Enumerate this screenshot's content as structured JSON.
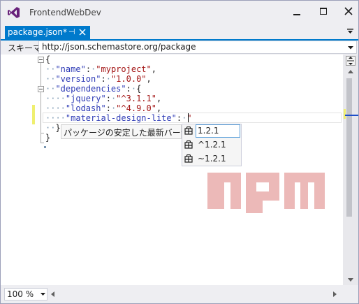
{
  "window": {
    "title": "FrontendWebDev"
  },
  "tab": {
    "label": "package.json*",
    "pin_glyph": "⊣"
  },
  "schema": {
    "label": "スキーマ:",
    "value": "http://json.schemastore.org/package"
  },
  "code": {
    "lines": [
      [
        {
          "t": "{",
          "c": "pun"
        }
      ],
      [
        {
          "t": "··",
          "c": "ws"
        },
        {
          "t": "\"name\"",
          "c": "key"
        },
        {
          "t": ":",
          "c": "pun"
        },
        {
          "t": "·",
          "c": "ws"
        },
        {
          "t": "\"myproject\"",
          "c": "str"
        },
        {
          "t": ",",
          "c": "pun"
        }
      ],
      [
        {
          "t": "··",
          "c": "ws"
        },
        {
          "t": "\"version\"",
          "c": "key"
        },
        {
          "t": ":",
          "c": "pun"
        },
        {
          "t": "·",
          "c": "ws"
        },
        {
          "t": "\"1.0.0\"",
          "c": "str"
        },
        {
          "t": ",",
          "c": "pun"
        }
      ],
      [
        {
          "t": "··",
          "c": "ws"
        },
        {
          "t": "\"dependencies\"",
          "c": "key"
        },
        {
          "t": ":",
          "c": "pun"
        },
        {
          "t": "·",
          "c": "ws"
        },
        {
          "t": "{",
          "c": "pun"
        }
      ],
      [
        {
          "t": "····",
          "c": "ws"
        },
        {
          "t": "\"jquery\"",
          "c": "key"
        },
        {
          "t": ":",
          "c": "pun"
        },
        {
          "t": "·",
          "c": "ws"
        },
        {
          "t": "\"^3.1.1\"",
          "c": "str"
        },
        {
          "t": ",",
          "c": "pun"
        }
      ],
      [
        {
          "t": "····",
          "c": "ws"
        },
        {
          "t": "\"lodash\"",
          "c": "key"
        },
        {
          "t": ":",
          "c": "pun"
        },
        {
          "t": "·",
          "c": "ws"
        },
        {
          "t": "\"^4.9.0\"",
          "c": "str"
        },
        {
          "t": ",",
          "c": "pun"
        }
      ],
      [
        {
          "t": "····",
          "c": "ws"
        },
        {
          "t": "\"material-design-lite\"",
          "c": "key"
        },
        {
          "t": ":",
          "c": "pun"
        },
        {
          "t": "·",
          "c": "ws"
        },
        {
          "t": "\"",
          "c": "str"
        }
      ],
      [
        {
          "t": "··",
          "c": "ws"
        },
        {
          "t": "}",
          "c": "pun"
        }
      ],
      [
        {
          "t": "}",
          "c": "pun"
        }
      ]
    ]
  },
  "tooltip": {
    "text": "パッケージの安定した最新バージョン"
  },
  "completion": {
    "items": [
      {
        "label": "1.2.1",
        "selected": true
      },
      {
        "label": "^1.2.1",
        "selected": false
      },
      {
        "label": "~1.2.1",
        "selected": false
      }
    ],
    "icon": "package-icon"
  },
  "watermark": {
    "text": "npm"
  },
  "status": {
    "zoom": "100 %"
  },
  "colors": {
    "accent": "#007acc",
    "string": "#a31515",
    "key": "#2e3bb6",
    "npm": "#cb3837"
  }
}
